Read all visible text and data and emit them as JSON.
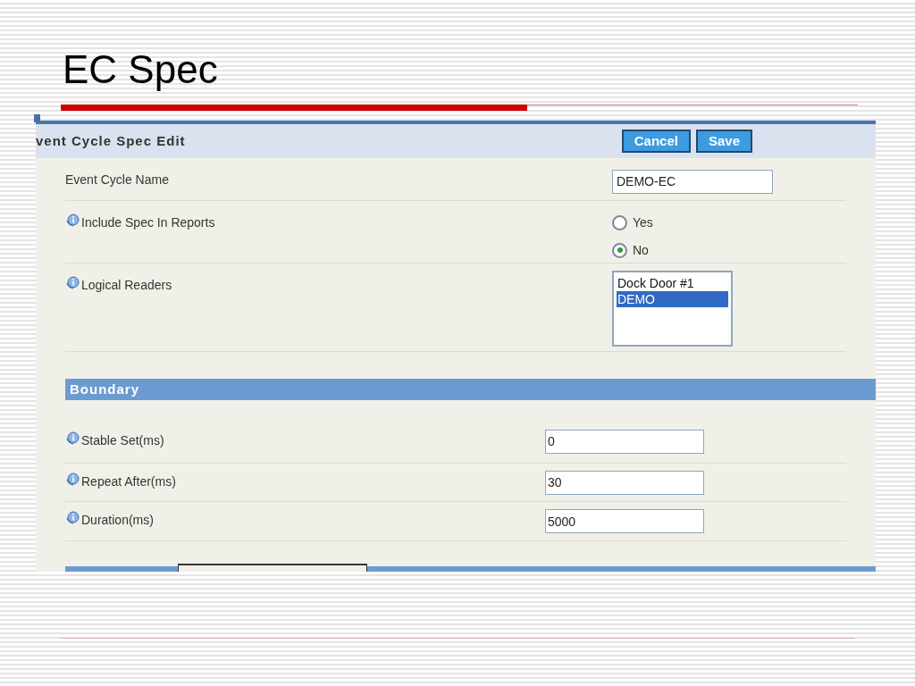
{
  "slide": {
    "title": "EC Spec"
  },
  "form": {
    "title": "vent Cycle Spec Edit",
    "buttons": [
      {
        "label": "Cancel"
      },
      {
        "label": "Save"
      }
    ],
    "fields": [
      {
        "kind": "text",
        "label": "Event Cycle Name",
        "info": false,
        "value": "DEMO-EC"
      },
      {
        "kind": "radio",
        "label": "Include Spec In Reports",
        "info": true,
        "options": [
          {
            "label": "Yes",
            "selected": false
          },
          {
            "label": "No",
            "selected": true
          }
        ]
      },
      {
        "kind": "list",
        "label": "Logical Readers",
        "info": true,
        "options": [
          {
            "label": "Dock Door #1",
            "selected": false
          },
          {
            "label": "DEMO",
            "selected": true
          }
        ]
      }
    ]
  },
  "boundary": {
    "title": "Boundary",
    "fields": [
      {
        "label": "Stable Set(ms)",
        "info": true,
        "value": "0"
      },
      {
        "label": "Repeat After(ms)",
        "info": true,
        "value": "30"
      },
      {
        "label": "Duration(ms)",
        "info": true,
        "value": "5000"
      }
    ]
  }
}
